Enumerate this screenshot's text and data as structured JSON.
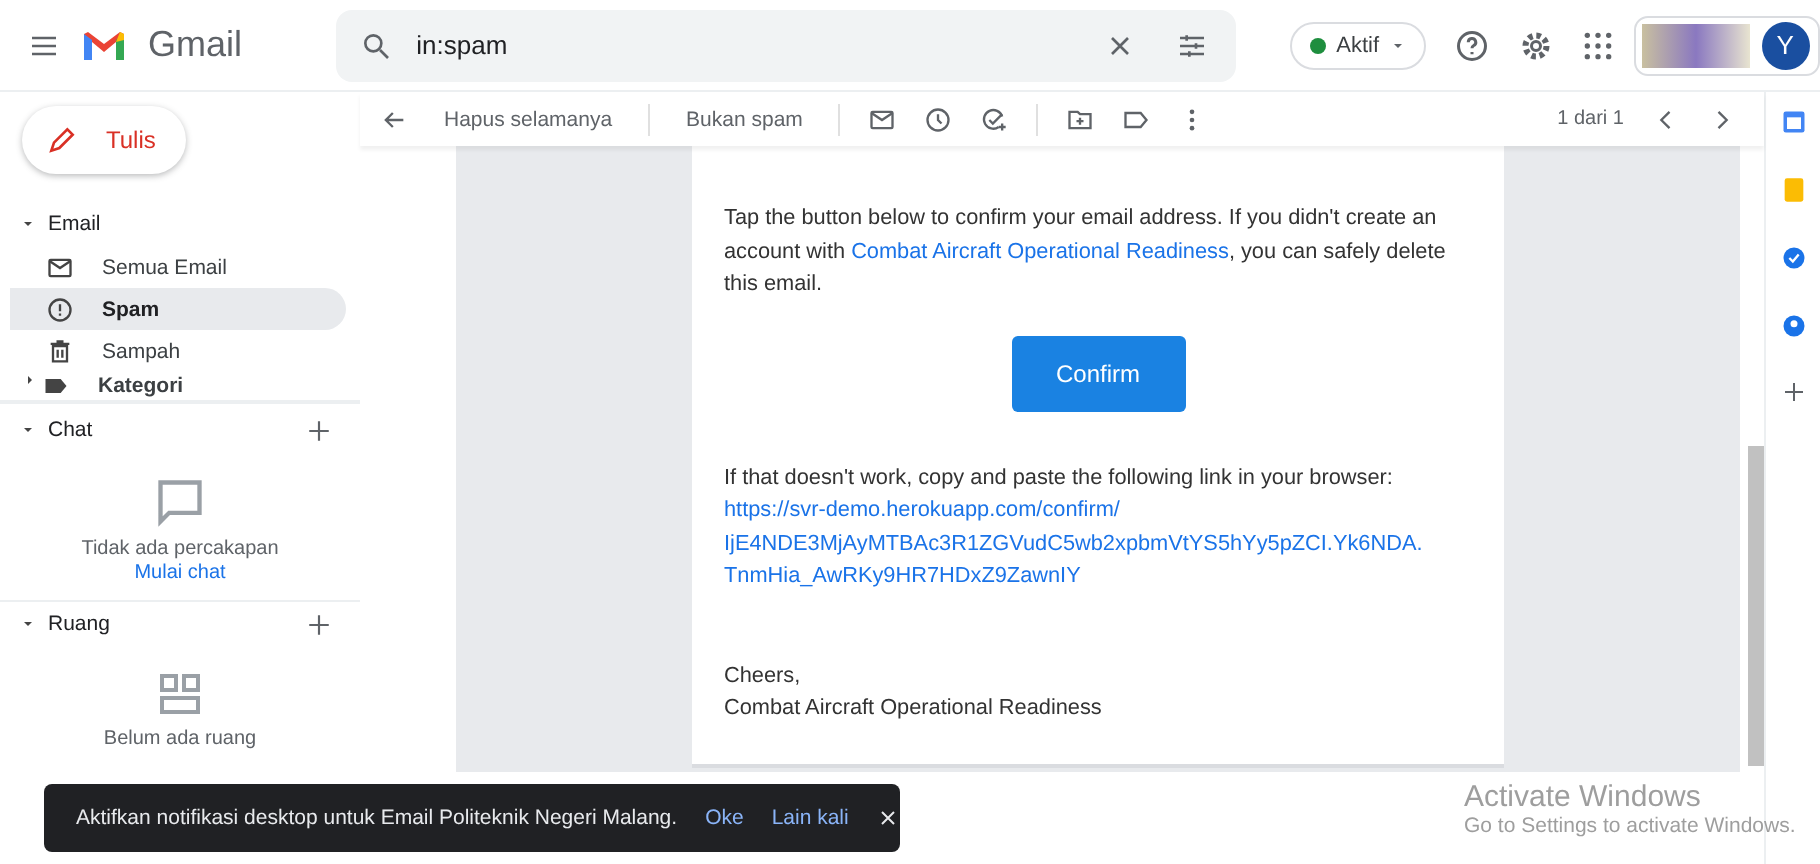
{
  "header": {
    "app_name": "Gmail",
    "search": {
      "value": "in:spam"
    },
    "status": {
      "label": "Aktif",
      "active": true
    },
    "avatar": "Y"
  },
  "sidebar": {
    "compose": "Tulis",
    "mail_section": {
      "title": "Email",
      "expanded": true,
      "items": [
        {
          "label": "Semua Email",
          "kind": "envelope",
          "selected": false,
          "bold": false
        },
        {
          "label": "Spam",
          "kind": "spam",
          "selected": true,
          "bold": true
        },
        {
          "label": "Sampah",
          "kind": "trash",
          "selected": false,
          "bold": false
        },
        {
          "label": "Kategori",
          "kind": "category",
          "selected": false,
          "bold": true
        }
      ]
    },
    "chat": {
      "title": "Chat",
      "expanded": true,
      "empty_text": "Tidak ada percakapan",
      "link": "Mulai chat"
    },
    "rooms": {
      "title": "Ruang",
      "expanded": true,
      "empty_text": "Belum ada ruang"
    }
  },
  "toolbar": {
    "actions": [
      "Hapus selamanya",
      "Bukan spam"
    ],
    "page_info": "1 dari 1"
  },
  "email": {
    "intro_before": "Tap the button below to confirm your email address. If you didn't create an account with ",
    "intro_link": "Combat Aircraft Operational Readiness",
    "intro_after": ", you can safely delete this email.",
    "button": "Confirm",
    "fallback": "If that doesn't work, copy and paste the following link in your browser:",
    "url_lines": [
      "https://svr-demo.herokuapp.com/confirm/",
      "IjE4NDE3MjAyMTBAc3R1ZGVudC5wb2xpbmVtYS5hYy5pZCI.Yk6NDA.",
      "TnmHia_AwRKy9HR7HDxZ9ZawnIY"
    ],
    "signoff": [
      "Cheers,",
      "Combat Aircraft Operational Readiness"
    ]
  },
  "snackbar": {
    "message": "Aktifkan notifikasi desktop untuk Email Politeknik Negeri Malang.",
    "actions": [
      "Oke",
      "Lain kali"
    ]
  },
  "os_notice": {
    "title": "Activate Windows",
    "subtitle": "Go to Settings to activate Windows."
  }
}
